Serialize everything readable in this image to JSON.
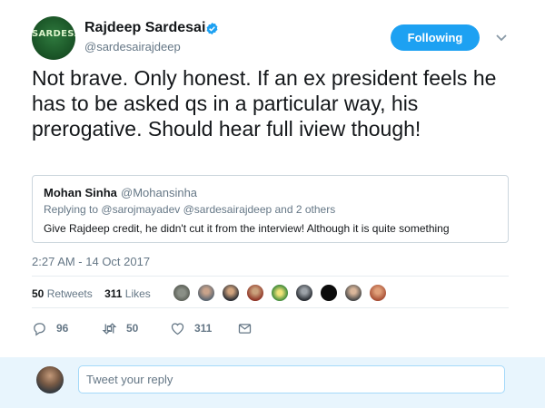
{
  "author": {
    "name": "Rajdeep Sardesai",
    "handle": "@sardesairajdeep",
    "avatar_text": "SARDESAI",
    "verified": true
  },
  "follow_button": {
    "label": "Following"
  },
  "tweet": {
    "text": "Not brave. Only honest. If an ex president feels he has to be asked qs in a particular way, his prerogative. Should hear full iview though!",
    "timestamp": "2:27 AM - 14 Oct 2017"
  },
  "quote": {
    "name": "Mohan Sinha",
    "handle": "@Mohansinha",
    "replying_prefix": "Replying to",
    "replying_to": "@sarojmayadev @sardesairajdeep and 2 others",
    "text": "Give Rajdeep credit, he didn't cut it from the interview! Although it is quite something"
  },
  "stats": {
    "retweets_count": "50",
    "retweets_label": "Retweets",
    "likes_count": "311",
    "likes_label": "Likes"
  },
  "actions": {
    "reply_count": "96",
    "retweet_count": "50",
    "like_count": "311"
  },
  "reply_box": {
    "placeholder": "Tweet your reply"
  },
  "colors": {
    "accent": "#1da1f2",
    "secondary_text": "#657786",
    "reply_bar_bg": "#e8f5fd"
  },
  "icons": [
    "verified-icon",
    "chevron-down-icon",
    "reply-icon",
    "retweet-icon",
    "like-icon",
    "message-icon"
  ]
}
